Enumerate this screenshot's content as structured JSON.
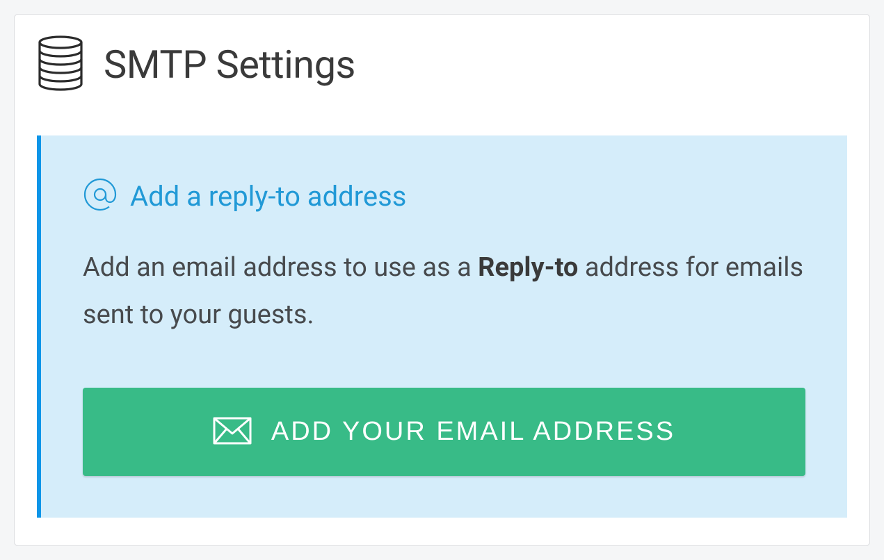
{
  "header": {
    "title": "SMTP Settings"
  },
  "panel": {
    "title": "Add a reply-to address",
    "description_prefix": "Add an email address to use as a ",
    "description_bold": "Reply-to",
    "description_suffix": " address for emails sent to your guests.",
    "button_label": "ADD YOUR EMAIL ADDRESS"
  },
  "colors": {
    "accent_blue": "#0d95e8",
    "panel_bg": "#d5edfa",
    "button_green": "#38bb87"
  }
}
